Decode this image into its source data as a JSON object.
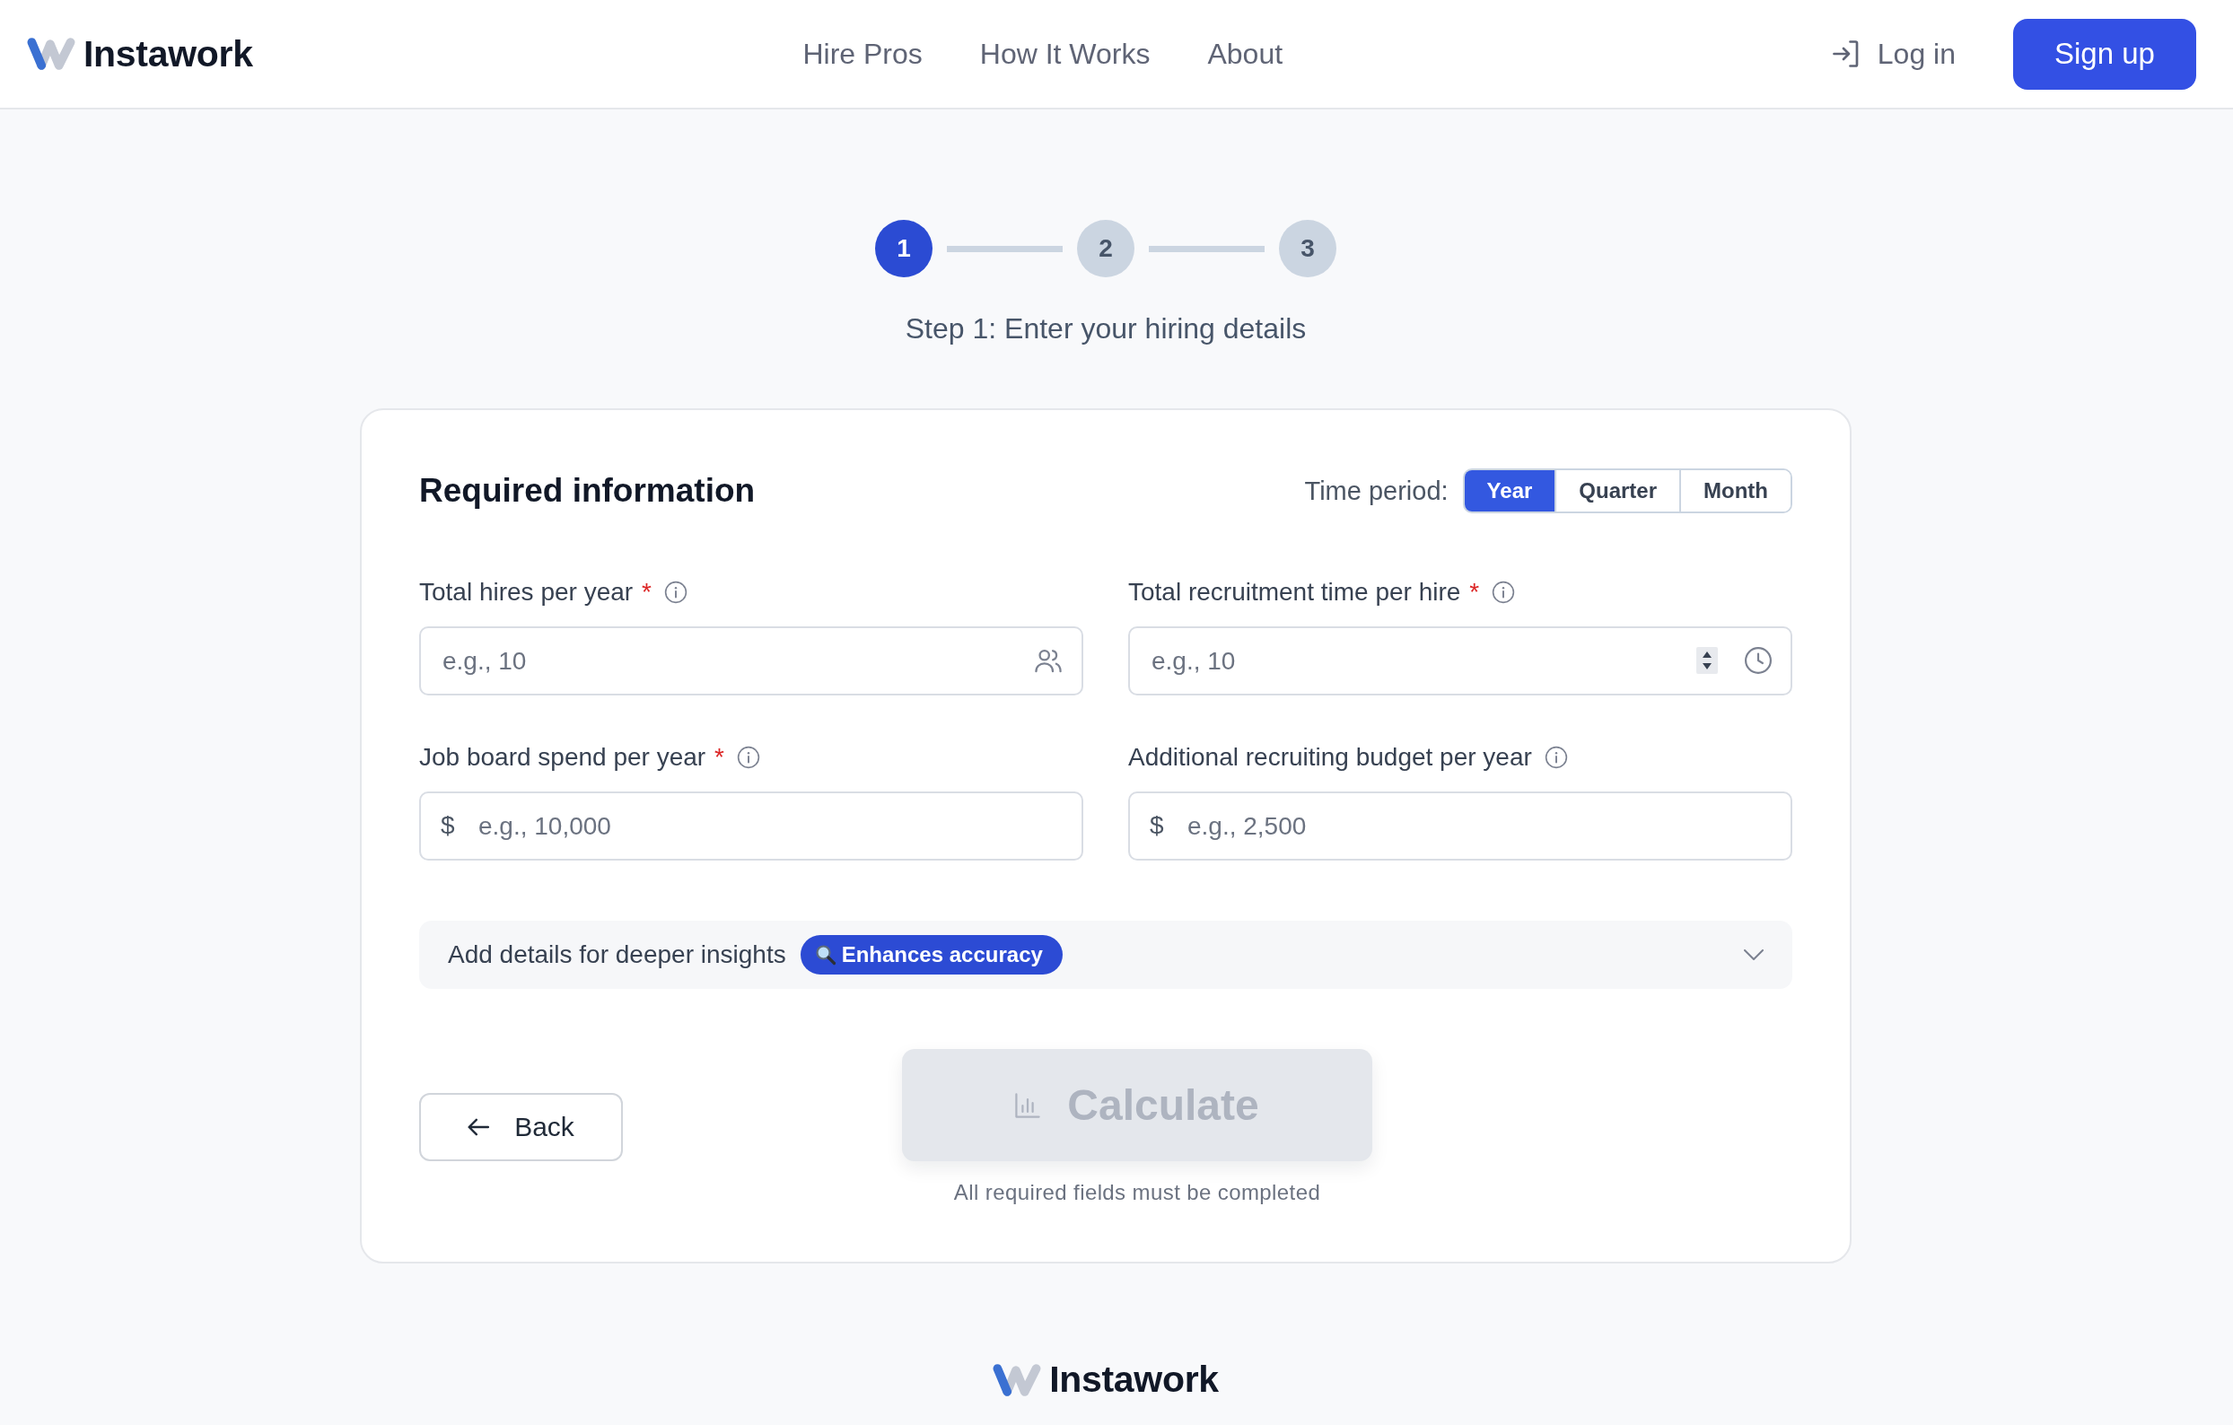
{
  "header": {
    "logo": "Instawork",
    "nav": [
      "Hire Pros",
      "How It Works",
      "About"
    ],
    "login": "Log in",
    "signup": "Sign up"
  },
  "stepper": {
    "steps": [
      {
        "number": "1",
        "selected": true
      },
      {
        "number": "2",
        "selected": false
      },
      {
        "number": "3",
        "selected": false
      }
    ],
    "caption": "Step 1: Enter your hiring details"
  },
  "form": {
    "title": "Required information",
    "time_period": {
      "label": "Time period:",
      "options": [
        {
          "label": "Year",
          "selected": true
        },
        {
          "label": "Quarter",
          "selected": false
        },
        {
          "label": "Month",
          "selected": false
        }
      ]
    },
    "fields": [
      {
        "kind": "count",
        "label": "Total hires per year",
        "required_mark": "*",
        "placeholder": "e.g., 10"
      },
      {
        "kind": "duration",
        "label": "Total recruitment time per hire",
        "required_mark": "*",
        "placeholder": "e.g., 10"
      },
      {
        "kind": "currency",
        "label": "Job board spend per year",
        "required_mark": "*",
        "prefix": "$",
        "placeholder": "e.g., 10,000"
      },
      {
        "kind": "currency",
        "label": "Additional recruiting budget per year",
        "prefix": "$",
        "placeholder": "e.g., 2,500"
      }
    ],
    "details": {
      "label": "Add details for deeper insights",
      "badge": "Enhances accuracy",
      "expanded": false
    },
    "back": "Back",
    "calculate": {
      "label": "Calculate",
      "disabled": true
    },
    "hint": "All required fields must be completed"
  },
  "footer": {
    "logo": "Instawork"
  }
}
